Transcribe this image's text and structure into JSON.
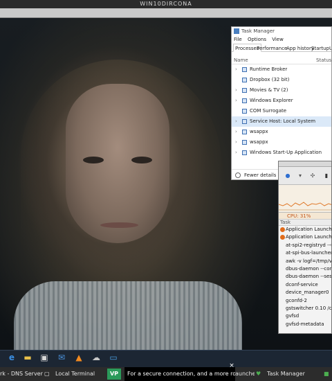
{
  "window_title": "WIN10DIRCONA",
  "task_manager": {
    "title": "Task Manager",
    "menu": [
      "File",
      "Options",
      "View"
    ],
    "tabs": [
      "Processes",
      "Performance",
      "App history",
      "Startup",
      "Us"
    ],
    "active_tab": "Processes",
    "columns": {
      "name": "Name",
      "status": "Status"
    },
    "rows": [
      {
        "label": "Runtime Broker",
        "expandable": true
      },
      {
        "label": "Dropbox (32 bit)",
        "expandable": false
      },
      {
        "label": "Movies & TV (2)",
        "expandable": true
      },
      {
        "label": "Windows Explorer",
        "expandable": true
      },
      {
        "label": "COM Surrogate",
        "expandable": false
      },
      {
        "label": "Service Host: Local System",
        "expandable": true,
        "selected": true
      },
      {
        "label": "wsappx",
        "expandable": true
      },
      {
        "label": "wsappx",
        "expandable": true
      },
      {
        "label": "Windows Start-Up Application",
        "expandable": true
      }
    ],
    "fewer_details": "Fewer details"
  },
  "system_monitor": {
    "cpu_label": "CPU: 31%",
    "column_task": "Task",
    "processes": [
      {
        "label": "Application Launche",
        "icon": true
      },
      {
        "label": "Application Launche",
        "icon": true
      },
      {
        "label": "at-spi2-registryd --u",
        "icon": false
      },
      {
        "label": "at-spi-bus-launcher",
        "icon": false
      },
      {
        "label": "awk -v logf=/tmp/v",
        "icon": false
      },
      {
        "label": "dbus-daemon --conf",
        "icon": false
      },
      {
        "label": "dbus-daemon --sess",
        "icon": false
      },
      {
        "label": "dconf-service",
        "icon": false
      },
      {
        "label": "device_manager0",
        "icon": false
      },
      {
        "label": "gconfd-2",
        "icon": false
      },
      {
        "label": "gstswitcher 0.10 /co",
        "icon": false
      },
      {
        "label": "gvfsd",
        "icon": false
      },
      {
        "label": "gvfsd-metadata",
        "icon": false
      }
    ]
  },
  "taskbar_icons": [
    "edge-icon",
    "folder-icon",
    "store-icon",
    "mail-icon",
    "vlc-icon",
    "network-icon",
    "screen-icon"
  ],
  "bottom_bar": {
    "item1": "rk - DNS Server...",
    "item2": "Local Terminal",
    "item3": "auncher",
    "item4": "Task Manager",
    "toast_text": "For a secure connection, and a more robust",
    "toast_close": "×",
    "vp_badge": "VP"
  }
}
